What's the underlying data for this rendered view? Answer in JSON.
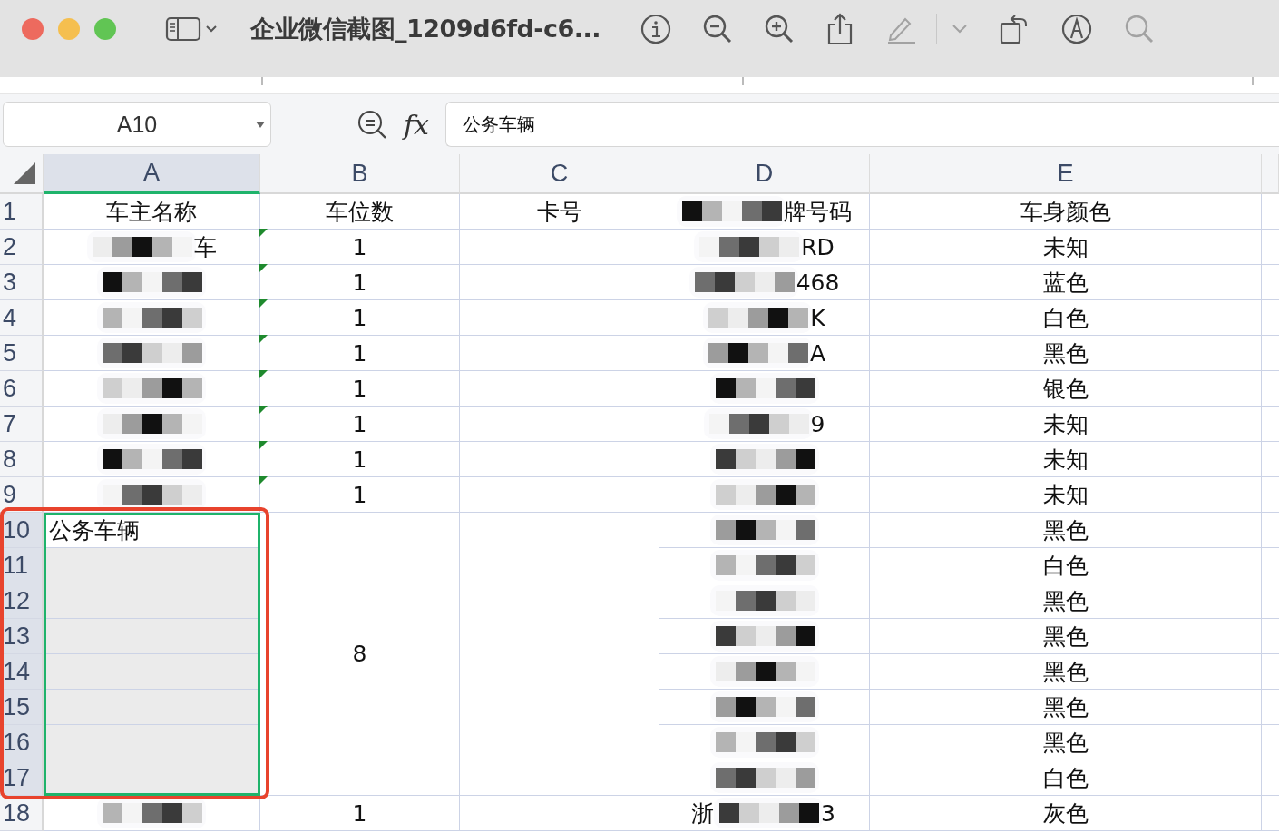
{
  "window": {
    "title": "企业微信截图_1209d6fd-c6..."
  },
  "toolbar": {
    "markup_disabled": true
  },
  "formula_bar": {
    "name_box": "A10",
    "function_label": "fx",
    "value": "公务车辆"
  },
  "columns": [
    {
      "label": "A",
      "selected": true
    },
    {
      "label": "B",
      "selected": false
    },
    {
      "label": "C",
      "selected": false
    },
    {
      "label": "D",
      "selected": false
    },
    {
      "label": "E",
      "selected": false
    }
  ],
  "rows": [
    {
      "number": "1",
      "selected": false,
      "owner": {
        "text": "车主名称"
      },
      "spaces": "车位数",
      "card": "卡号",
      "plate": {
        "redacted": true,
        "suffix": "牌号码"
      },
      "body_color": "车身颜色"
    },
    {
      "number": "2",
      "selected": false,
      "owner": {
        "redacted": true,
        "suffix": "车"
      },
      "spaces": "1",
      "flag": true,
      "plate": {
        "redacted": true,
        "suffix": "RD"
      },
      "body_color": "未知"
    },
    {
      "number": "3",
      "selected": false,
      "owner": {
        "redacted": true
      },
      "spaces": "1",
      "flag": true,
      "plate": {
        "redacted": true,
        "suffix": "468"
      },
      "body_color": "蓝色"
    },
    {
      "number": "4",
      "selected": false,
      "owner": {
        "redacted": true
      },
      "spaces": "1",
      "flag": true,
      "plate": {
        "redacted": true,
        "suffix": "K"
      },
      "body_color": "白色"
    },
    {
      "number": "5",
      "selected": false,
      "owner": {
        "redacted": true
      },
      "spaces": "1",
      "flag": true,
      "plate": {
        "redacted": true,
        "suffix": "A"
      },
      "body_color": "黑色"
    },
    {
      "number": "6",
      "selected": false,
      "owner": {
        "redacted": true
      },
      "spaces": "1",
      "flag": true,
      "plate": {
        "redacted": true
      },
      "body_color": "银色"
    },
    {
      "number": "7",
      "selected": false,
      "owner": {
        "redacted": true
      },
      "spaces": "1",
      "flag": true,
      "plate": {
        "redacted": true,
        "suffix": "9"
      },
      "body_color": "未知"
    },
    {
      "number": "8",
      "selected": false,
      "owner": {
        "redacted": true
      },
      "spaces": "1",
      "flag": true,
      "plate": {
        "redacted": true
      },
      "body_color": "未知"
    },
    {
      "number": "9",
      "selected": false,
      "owner": {
        "redacted": true
      },
      "spaces": "1",
      "flag": true,
      "plate": {
        "redacted": true
      },
      "body_color": "未知"
    },
    {
      "number": "10",
      "selected": true,
      "owner": {
        "text": "公务车辆",
        "active": true
      },
      "spaces": "8",
      "plate": {
        "redacted": true
      },
      "body_color": "黑色"
    },
    {
      "number": "11",
      "selected": true,
      "owner": {
        "active": false
      },
      "plate": {
        "redacted": true
      },
      "body_color": "白色"
    },
    {
      "number": "12",
      "selected": true,
      "owner": {
        "active": false
      },
      "plate": {
        "redacted": true
      },
      "body_color": "黑色"
    },
    {
      "number": "13",
      "selected": true,
      "owner": {
        "active": false
      },
      "plate": {
        "redacted": true
      },
      "body_color": "黑色"
    },
    {
      "number": "14",
      "selected": true,
      "owner": {
        "active": false
      },
      "plate": {
        "redacted": true
      },
      "body_color": "黑色"
    },
    {
      "number": "15",
      "selected": true,
      "owner": {
        "active": false
      },
      "plate": {
        "redacted": true
      },
      "body_color": "黑色"
    },
    {
      "number": "16",
      "selected": true,
      "owner": {
        "active": false
      },
      "plate": {
        "redacted": true
      },
      "body_color": "黑色"
    },
    {
      "number": "17",
      "selected": true,
      "owner": {
        "active": false
      },
      "plate": {
        "redacted": true
      },
      "body_color": "白色"
    },
    {
      "number": "18",
      "selected": false,
      "owner": {
        "redacted": true
      },
      "spaces": "1",
      "plate": {
        "prefix": "浙",
        "redacted": true,
        "suffix": "3"
      },
      "body_color": "灰色"
    }
  ]
}
